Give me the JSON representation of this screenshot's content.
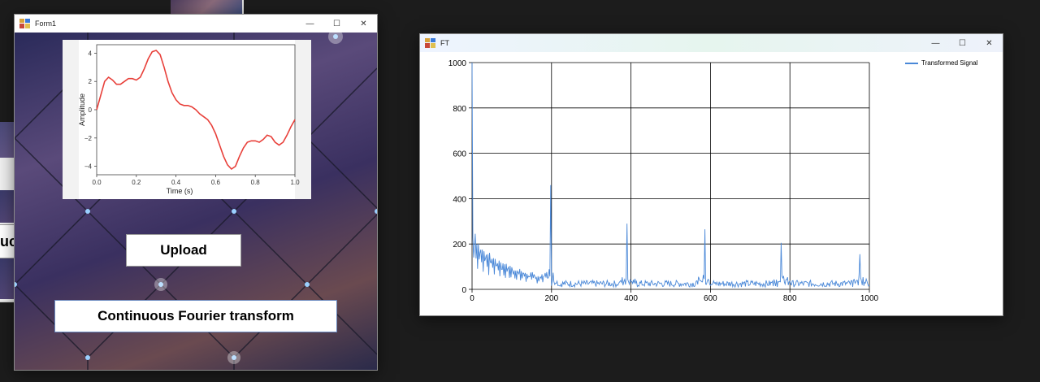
{
  "background_windows": {
    "partial_button_text": "uc"
  },
  "form1": {
    "title": "Form1",
    "controls": {
      "minimize": "—",
      "maximize": "☐",
      "close": "✕"
    },
    "plot": {
      "ylabel": "Amplitude",
      "xlabel": "Time (s)",
      "x_ticks": [
        "0.0",
        "0.2",
        "0.4",
        "0.6",
        "0.8",
        "1.0"
      ],
      "y_ticks": [
        "4",
        "2",
        "0",
        "−2",
        "−4"
      ],
      "line_color": "#e8403a"
    },
    "upload_button": "Upload",
    "cft_button": "Continuous Fourier transform"
  },
  "ft_window": {
    "title": "FT",
    "controls": {
      "minimize": "—",
      "maximize": "☐",
      "close": "✕"
    },
    "legend_label": "Transformed Signal",
    "x_ticks": [
      "0",
      "200",
      "400",
      "600",
      "800",
      "1000"
    ],
    "y_ticks": [
      "1000",
      "800",
      "600",
      "400",
      "200",
      "0"
    ],
    "line_color": "#4a88d8"
  },
  "chart_data": [
    {
      "type": "line",
      "xlabel": "Time (s)",
      "ylabel": "Amplitude",
      "xlim": [
        0,
        1
      ],
      "ylim": [
        -4.6,
        4.6
      ],
      "series": [
        {
          "x": [
            0.0,
            0.02,
            0.04,
            0.06,
            0.08,
            0.1,
            0.12,
            0.14,
            0.16,
            0.18,
            0.2,
            0.22,
            0.24,
            0.26,
            0.28,
            0.3,
            0.32,
            0.34,
            0.36,
            0.38,
            0.4,
            0.42,
            0.44,
            0.46,
            0.48,
            0.5,
            0.52,
            0.54,
            0.56,
            0.58,
            0.6,
            0.62,
            0.64,
            0.66,
            0.68,
            0.7,
            0.72,
            0.74,
            0.76,
            0.78,
            0.8,
            0.82,
            0.84,
            0.86,
            0.88,
            0.9,
            0.92,
            0.94,
            0.96,
            0.98,
            1.0
          ],
          "y": [
            0.0,
            1.0,
            2.0,
            2.3,
            2.1,
            1.8,
            1.8,
            2.0,
            2.2,
            2.2,
            2.1,
            2.3,
            2.9,
            3.6,
            4.1,
            4.2,
            3.9,
            3.0,
            2.0,
            1.2,
            0.7,
            0.4,
            0.3,
            0.3,
            0.2,
            0.0,
            -0.3,
            -0.5,
            -0.7,
            -1.1,
            -1.7,
            -2.5,
            -3.3,
            -3.9,
            -4.2,
            -4.0,
            -3.3,
            -2.7,
            -2.3,
            -2.2,
            -2.2,
            -2.3,
            -2.1,
            -1.8,
            -1.9,
            -2.3,
            -2.5,
            -2.3,
            -1.8,
            -1.2,
            -0.7
          ]
        }
      ]
    },
    {
      "type": "line",
      "xlim": [
        0,
        1000
      ],
      "ylim": [
        0,
        1000
      ],
      "grid": true,
      "legend": "top-right",
      "series": [
        {
          "name": "Transformed Signal",
          "peaks": [
            {
              "x": 0,
              "y": 1000
            },
            {
              "x": 8,
              "y": 245
            },
            {
              "x": 198,
              "y": 460
            },
            {
              "x": 390,
              "y": 290
            },
            {
              "x": 586,
              "y": 265
            },
            {
              "x": 778,
              "y": 205
            },
            {
              "x": 977,
              "y": 155
            }
          ],
          "baseline_pattern": "decaying oscillation ~200 near 0 to ~20 by x=200, then noise 10-40 with clusters near 200, 390, 586, 778, 977"
        }
      ]
    }
  ]
}
